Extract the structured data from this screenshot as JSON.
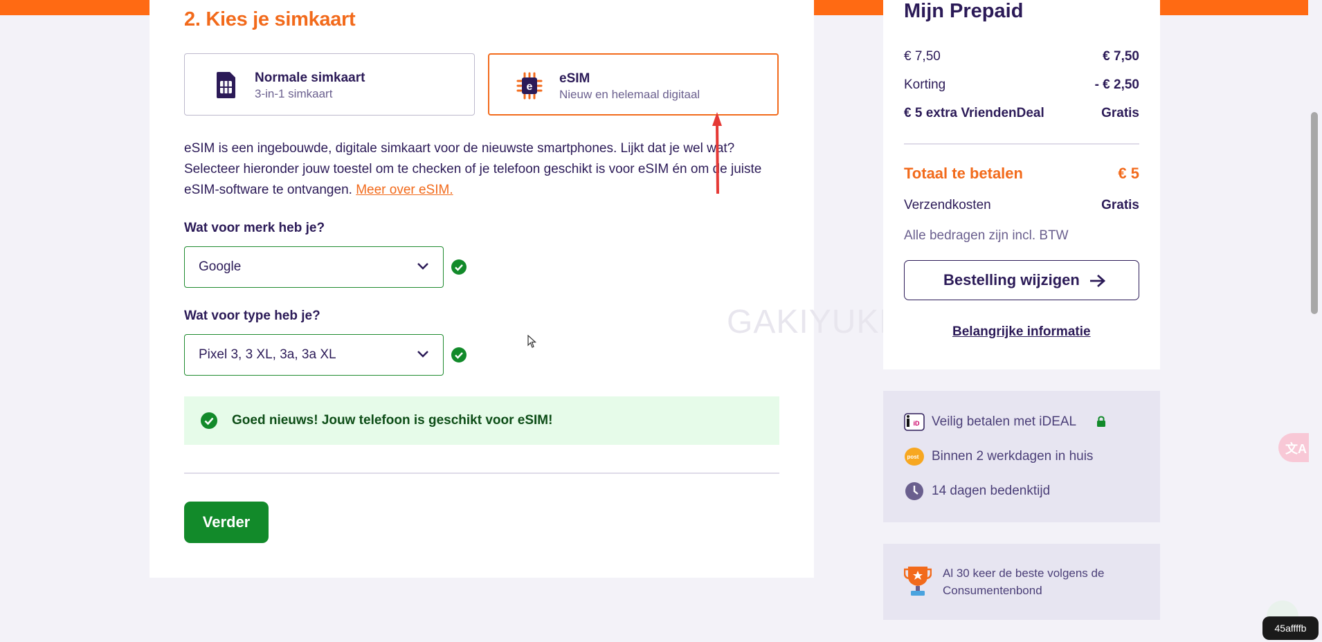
{
  "colors": {
    "brand_orange": "#f26a1b",
    "brand_purple": "#2b1a57",
    "success_green": "#128a2a",
    "success_bg": "#e6fbe9"
  },
  "section": {
    "title": "2. Kies je simkaart",
    "options": [
      {
        "title": "Normale simkaart",
        "subtitle": "3-in-1 simkaart",
        "icon": "sim-card-icon",
        "selected": false
      },
      {
        "title": "eSIM",
        "subtitle": "Nieuw en helemaal digitaal",
        "icon": "esim-chip-icon",
        "selected": true
      }
    ],
    "description": "eSIM is een ingebouwde, digitale simkaart voor de nieuwste smartphones. Lijkt dat je wel wat? Selecteer hieronder jouw toestel om te checken of je telefoon geschikt is voor eSIM én om de juiste eSIM-software te ontvangen. ",
    "description_link": "Meer over eSIM.",
    "brand": {
      "label": "Wat voor merk heb je?",
      "value": "Google",
      "valid": true
    },
    "type": {
      "label": "Wat voor type heb je?",
      "value": "Pixel 3, 3 XL, 3a, 3a XL",
      "valid": true
    },
    "success_message": "Goed nieuws! Jouw telefoon is geschikt voor eSIM!",
    "next_button": "Verder",
    "watermark": "GAKIYUKR"
  },
  "summary": {
    "title": "Mijn Prepaid",
    "rows": [
      {
        "label": "€ 7,50",
        "value": "€ 7,50"
      },
      {
        "label": "Korting",
        "value": "- € 2,50"
      },
      {
        "label": "€ 5 extra VriendenDeal",
        "value": "Gratis"
      }
    ],
    "total_label": "Totaal te betalen",
    "total_value": "€ 5",
    "shipping_label": "Verzendkosten",
    "shipping_value": "Gratis",
    "btw_note": "Alle bedragen zijn incl. BTW",
    "change_button": "Bestelling wijzigen",
    "info_link": "Belangrijke informatie"
  },
  "usps": [
    {
      "icon": "ideal-icon",
      "text": "Veilig betalen met iDEAL",
      "icon_text": "iD"
    },
    {
      "icon": "postnl-icon",
      "text": "Binnen 2 werkdagen in huis",
      "icon_text": "post"
    },
    {
      "icon": "clock-icon",
      "text": "14 dagen bedenktijd"
    }
  ],
  "award": {
    "icon": "trophy-icon",
    "text": "Al 30 keer de beste volgens de Consumentenbond"
  },
  "overlay": {
    "hash": "45affffb",
    "translate_glyph": "文A"
  }
}
